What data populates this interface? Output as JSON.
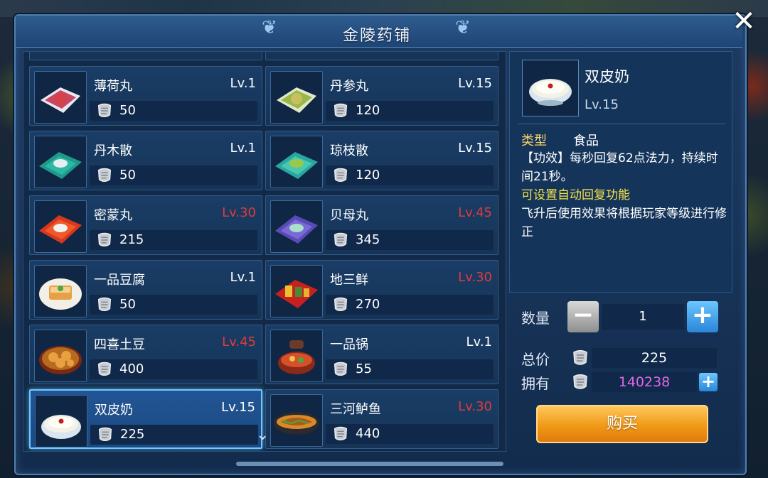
{
  "shop": {
    "title": "金陵药铺",
    "close_label": "✕"
  },
  "items": [
    {
      "name": "薄荷丸",
      "level": "Lv.1",
      "price": "50",
      "level_color": "#ffffff",
      "icon": "mint-pill-icon"
    },
    {
      "name": "丹参丸",
      "level": "Lv.15",
      "price": "120",
      "level_color": "#ffffff",
      "icon": "danshen-pill-icon"
    },
    {
      "name": "丹木散",
      "level": "Lv.1",
      "price": "50",
      "level_color": "#ffffff",
      "icon": "danmu-powder-icon"
    },
    {
      "name": "琼枝散",
      "level": "Lv.15",
      "price": "120",
      "level_color": "#ffffff",
      "icon": "qiongzhi-powder-icon"
    },
    {
      "name": "密蒙丸",
      "level": "Lv.30",
      "price": "215",
      "level_color": "#e03a3a",
      "icon": "mimeng-pill-icon"
    },
    {
      "name": "贝母丸",
      "level": "Lv.45",
      "price": "345",
      "level_color": "#e03a3a",
      "icon": "beimu-pill-icon"
    },
    {
      "name": "一品豆腐",
      "level": "Lv.1",
      "price": "50",
      "level_color": "#ffffff",
      "icon": "tofu-dish-icon"
    },
    {
      "name": "地三鲜",
      "level": "Lv.30",
      "price": "270",
      "level_color": "#e03a3a",
      "icon": "disanxian-dish-icon"
    },
    {
      "name": "四喜土豆",
      "level": "Lv.45",
      "price": "400",
      "level_color": "#e03a3a",
      "icon": "potato-dish-icon"
    },
    {
      "name": "一品锅",
      "level": "Lv.1",
      "price": "55",
      "level_color": "#ffffff",
      "icon": "hotpot-dish-icon"
    },
    {
      "name": "双皮奶",
      "level": "Lv.15",
      "price": "225",
      "level_color": "#ffffff",
      "icon": "milk-pudding-icon"
    },
    {
      "name": "三河鲈鱼",
      "level": "Lv.30",
      "price": "440",
      "level_color": "#e03a3a",
      "icon": "fish-dish-icon"
    }
  ],
  "detail": {
    "name": "双皮奶",
    "level": "Lv.15",
    "type_label": "类型",
    "type_value": "食品",
    "effect": "【功效】每秒回复62点法力，持续时间21秒。",
    "auto_note": "可设置自动回复功能",
    "note": "飞升后使用效果将根据玩家等级进行修正"
  },
  "purchase": {
    "qty_label": "数量",
    "qty_value": "1",
    "minus_label": "−",
    "plus_label": "+",
    "total_label": "总价",
    "total_value": "225",
    "own_label": "拥有",
    "own_value": "140238",
    "buy_label": "购买"
  },
  "colors": {
    "accent": "#6fc8ff",
    "locked_level": "#e03a3a",
    "currency_owned": "#e066e6",
    "buy_button": "#f09a18"
  }
}
